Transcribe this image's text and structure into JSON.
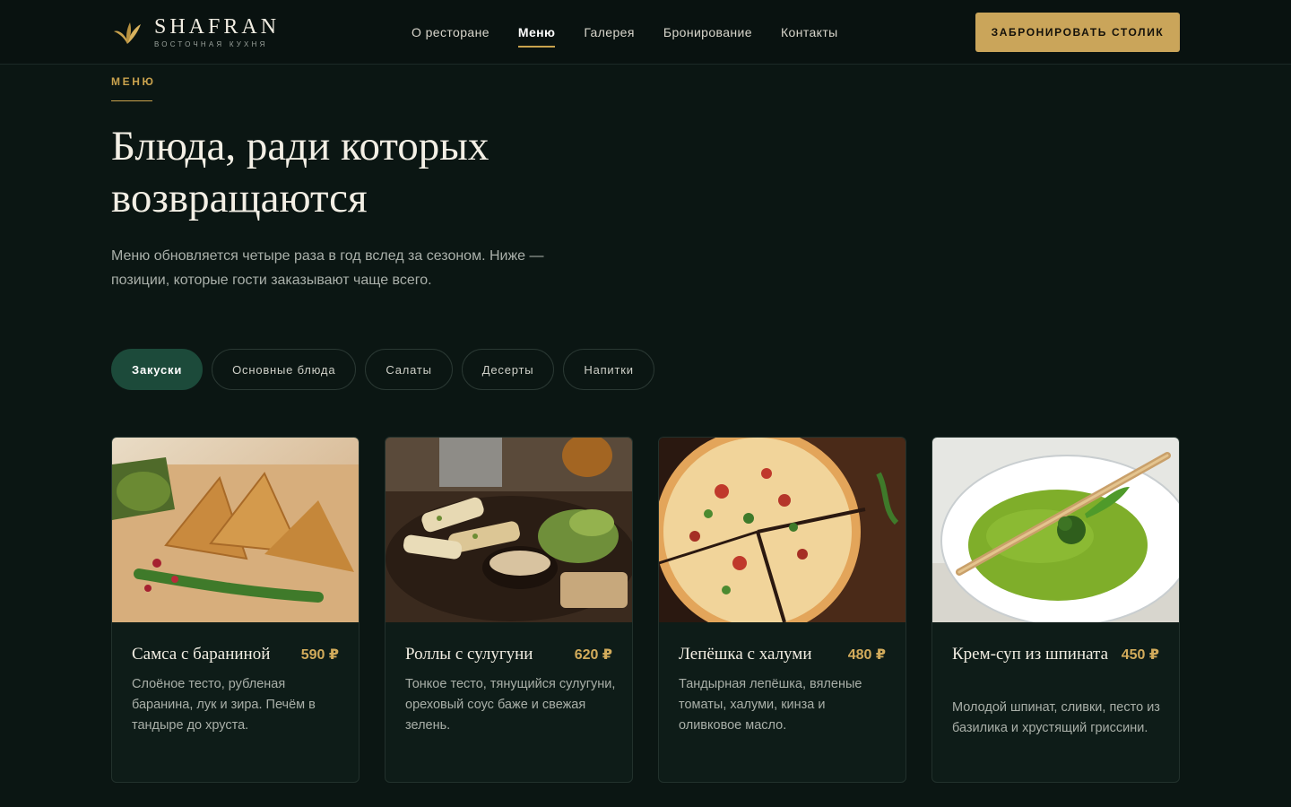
{
  "brand": {
    "name": "SHAFRAN",
    "tagline": "ВОСТОЧНАЯ КУХНЯ",
    "accent_color": "#c9a24d"
  },
  "nav": {
    "items": [
      {
        "label": "О ресторане",
        "active": false
      },
      {
        "label": "Меню",
        "active": true
      },
      {
        "label": "Галерея",
        "active": false
      },
      {
        "label": "Бронирование",
        "active": false
      },
      {
        "label": "Контакты",
        "active": false
      }
    ],
    "cta_label": "ЗАБРОНИРОВАТЬ СТОЛИК"
  },
  "hero": {
    "eyebrow": "МЕНЮ",
    "title_line1": "Блюда, ради которых",
    "title_line2": "возвращаются",
    "lead": "Меню обновляется четыре раза в год вслед за сезоном. Ниже — позиции, которые гости заказывают чаще всего."
  },
  "tabs": [
    {
      "label": "Закуски",
      "active": true
    },
    {
      "label": "Основные блюда",
      "active": false
    },
    {
      "label": "Салаты",
      "active": false
    },
    {
      "label": "Десерты",
      "active": false
    },
    {
      "label": "Напитки",
      "active": false
    }
  ],
  "dishes": [
    {
      "title": "Самса с бараниной",
      "price": "590 ₽",
      "description": "Слоёное тесто, рубленая баранина, лук и зира. Печём в тандыре до хруста.",
      "photo": "samsa-photo"
    },
    {
      "title": "Роллы с сулугуни",
      "price": "620 ₽",
      "description": "Тонкое тесто, тянущийся сулугуни, ореховый соус баже и свежая зелень.",
      "photo": "suluguni-rolls-photo"
    },
    {
      "title": "Лепёшка с халуми",
      "price": "480 ₽",
      "description": "Тандырная лепёшка, вяленые томаты, халуми, кинза и оливковое масло.",
      "photo": "halloumi-flatbread-photo"
    },
    {
      "title": "Крем-суп из шпината",
      "price": "450 ₽",
      "description": "Молодой шпинат, сливки, песто из базилика и хрустящий гриссини.",
      "photo": "spinach-soup-photo"
    }
  ]
}
